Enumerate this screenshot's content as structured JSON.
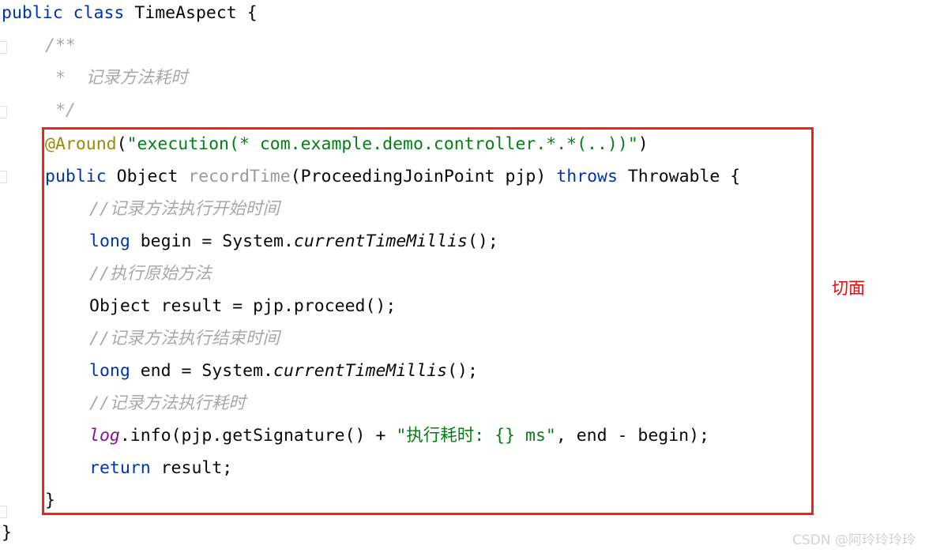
{
  "editor": {
    "language": "Java",
    "background_color": "#ffffff",
    "font_size_px": 21.5,
    "line_height_px": 41,
    "colors": {
      "keyword": "#0033b3",
      "string": "#067d17",
      "annotation": "#9e880d",
      "comment": "#a8a8a8",
      "plain_text": "#080808",
      "declared_method": "#9a9a9a",
      "field": "#871094",
      "highlight_box": "#f62114",
      "callout_text": "#ff0000",
      "watermark": "#d2d2d2"
    }
  },
  "code": {
    "line_01": {
      "kw_public": "public",
      "sp1": " ",
      "kw_class": "class",
      "sp2": " ",
      "type_name": "TimeAspect",
      "brace": " {"
    },
    "line_02": {
      "text": "/**"
    },
    "line_03": {
      "text": " *  记录方法耗时"
    },
    "line_04": {
      "text": " */"
    },
    "line_05": {
      "annotation": "@Around",
      "open_paren": "(",
      "string": "\"execution(* com.example.demo.controller.*.*(..))\"",
      "close_paren": ")"
    },
    "line_06": {
      "kw_public": "public",
      "sp1": " ",
      "type_object": "Object",
      "sp2": " ",
      "method_name": "recordTime",
      "params": "(ProceedingJoinPoint pjp) ",
      "kw_throws": "throws",
      "tail": " Throwable {"
    },
    "line_07": {
      "text": "//记录方法执行开始时间"
    },
    "line_08": {
      "kw_long": "long",
      "mid": " begin = System.",
      "static_call": "currentTimeMillis",
      "tail": "();"
    },
    "line_09": {
      "text": "//执行原始方法"
    },
    "line_10": {
      "text": "Object result = pjp.proceed();"
    },
    "line_11": {
      "text": "//记录方法执行结束时间"
    },
    "line_12": {
      "kw_long": "long",
      "mid": " end = System.",
      "static_call": "currentTimeMillis",
      "tail": "();"
    },
    "line_13": {
      "text": "//记录方法执行耗时"
    },
    "line_14": {
      "field": "log",
      "mid": ".info(pjp.getSignature() + ",
      "string": "\"执行耗时: {} ms\"",
      "tail": ", end - begin);"
    },
    "line_15": {
      "kw_return": "return",
      "tail": " result;"
    },
    "line_16": {
      "text": "}"
    },
    "line_17": {
      "text": "}"
    }
  },
  "annotations": {
    "callout_label": "切面",
    "highlight_box_name": "aspect-method-highlight"
  },
  "watermark": {
    "text": "CSDN @阿玲玲玲玲"
  }
}
